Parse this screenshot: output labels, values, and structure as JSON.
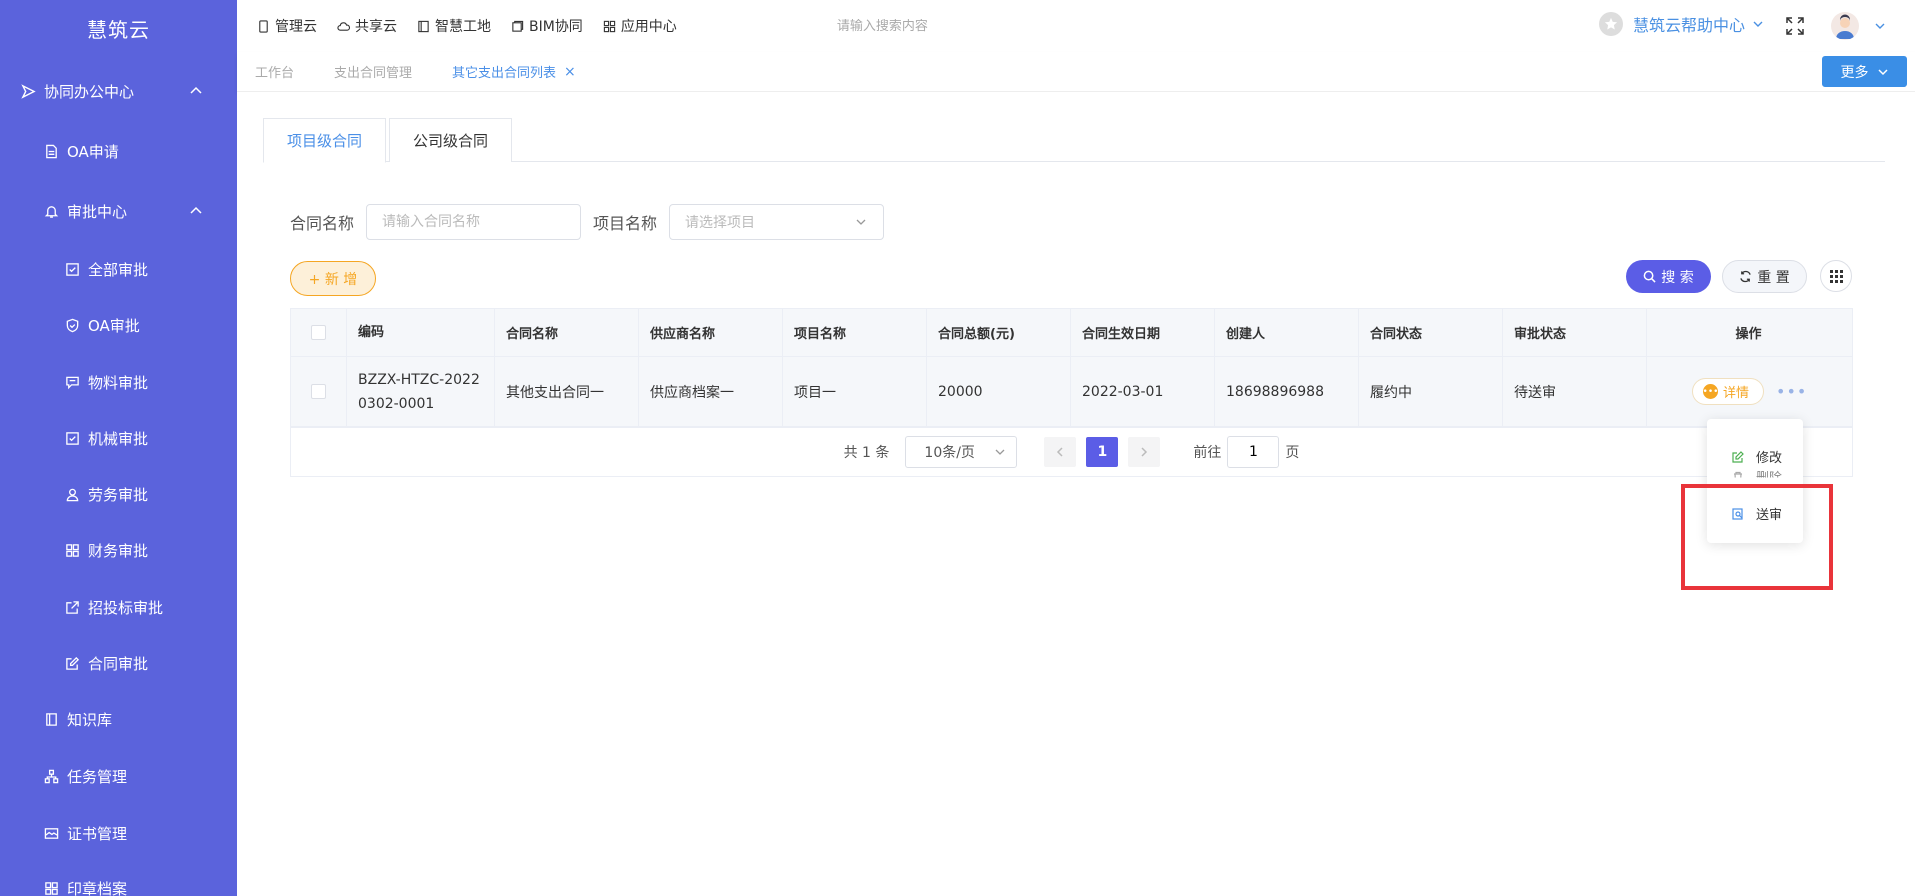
{
  "app": {
    "logo": "慧筑云"
  },
  "sidebar": {
    "items": [
      {
        "label": "协同办公中心",
        "icon": "send-icon"
      },
      {
        "label": "OA申请",
        "icon": "document-icon"
      },
      {
        "label": "审批中心",
        "icon": "bell-icon"
      },
      {
        "label": "全部审批",
        "icon": "checkbox-icon"
      },
      {
        "label": "OA审批",
        "icon": "shield-icon"
      },
      {
        "label": "物料审批",
        "icon": "message-icon"
      },
      {
        "label": "机械审批",
        "icon": "checkbox-icon"
      },
      {
        "label": "劳务审批",
        "icon": "user-icon"
      },
      {
        "label": "财务审批",
        "icon": "grid-icon"
      },
      {
        "label": "招投标审批",
        "icon": "external-icon"
      },
      {
        "label": "合同审批",
        "icon": "edit-icon"
      },
      {
        "label": "知识库",
        "icon": "book-icon"
      },
      {
        "label": "任务管理",
        "icon": "org-icon"
      },
      {
        "label": "证书管理",
        "icon": "card-icon"
      },
      {
        "label": "印章档案",
        "icon": "grid-icon"
      }
    ]
  },
  "header": {
    "nav": [
      "管理云",
      "共享云",
      "智慧工地",
      "BIM协同",
      "应用中心"
    ],
    "search_placeholder": "请输入搜索内容",
    "help": "慧筑云帮助中心"
  },
  "tabsbar": {
    "tabs": [
      "工作台",
      "支出合同管理",
      "其它支出合同列表"
    ],
    "close": "×",
    "more": "更多"
  },
  "subtabs": [
    "项目级合同",
    "公司级合同"
  ],
  "filter": {
    "contract_name_label": "合同名称",
    "contract_name_placeholder": "请输入合同名称",
    "project_name_label": "项目名称",
    "project_name_placeholder": "请选择项目"
  },
  "toolbar": {
    "add": "+ 新 增",
    "search": "搜 索",
    "reset": "重 置"
  },
  "table": {
    "headers": [
      "编码",
      "合同名称",
      "供应商名称",
      "项目名称",
      "合同总额(元)",
      "合同生效日期",
      "创建人",
      "合同状态",
      "审批状态",
      "操作"
    ],
    "rows": [
      {
        "code": "BZZX-HTZC-20220302-0001",
        "contract_name": "其他支出合同一",
        "supplier": "供应商档案一",
        "project": "项目一",
        "amount": "20000",
        "effective_date": "2022-03-01",
        "creator": "18698896988",
        "contract_status": "履约中",
        "approval_status": "待送审",
        "detail": "详情",
        "more": "•••"
      }
    ]
  },
  "pagination": {
    "total": "共 1 条",
    "page_size": "10条/页",
    "current_page": "1",
    "goto_label": "前往",
    "goto_value": "1",
    "page_suffix": "页"
  },
  "dropdown": {
    "items": [
      "修改",
      "删除",
      "送审"
    ]
  }
}
